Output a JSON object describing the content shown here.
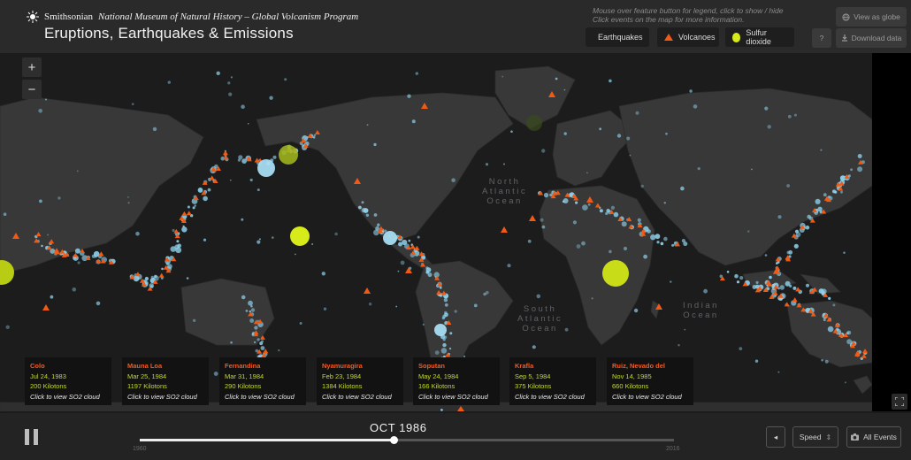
{
  "header": {
    "org_lead": "Smithsonian",
    "org_rest": "National Museum of Natural History – Global Volcanism Program",
    "title": "Eruptions, Earthquakes & Emissions",
    "hint_line1": "Mouse over feature button for legend, click to show / hide",
    "hint_line2": "Click events on the map for more information.",
    "legend": {
      "earthquakes": "Earthquakes",
      "volcanoes": "Volcanoes",
      "so2": "Sulfur dioxide"
    },
    "globe_button": "View as globe",
    "help_button": "?",
    "download_button": "Download data"
  },
  "map": {
    "zoom_in": "+",
    "zoom_out": "−",
    "oceans": {
      "north_atlantic": "North\nAtlantic\nOcean",
      "south_atlantic": "South\nAtlantic\nOcean",
      "indian": "Indian\nOcean"
    }
  },
  "events": [
    {
      "name": "Colo",
      "date": "Jul 24, 1983",
      "kilotons": "200 Kilotons",
      "link": "Click to view SO2 cloud"
    },
    {
      "name": "Mauna Loa",
      "date": "Mar 25, 1984",
      "kilotons": "1197 Kilotons",
      "link": "Click to view SO2 cloud"
    },
    {
      "name": "Fernandina",
      "date": "Mar 31, 1984",
      "kilotons": "290 Kilotons",
      "link": "Click to view SO2 cloud"
    },
    {
      "name": "Nyamuragira",
      "date": "Feb 23, 1984",
      "kilotons": "1384 Kilotons",
      "link": "Click to view SO2 cloud"
    },
    {
      "name": "Soputan",
      "date": "May 24, 1984",
      "kilotons": "166 Kilotons",
      "link": "Click to view SO2 cloud"
    },
    {
      "name": "Krafla",
      "date": "Sep 5, 1984",
      "kilotons": "375 Kilotons",
      "link": "Click to view SO2 cloud"
    },
    {
      "name": "Ruiz, Nevado del",
      "date": "Nov 14, 1985",
      "kilotons": "660 Kilotons",
      "link": "Click to view SO2 cloud"
    }
  ],
  "timeline": {
    "current_date": "OCT  1986",
    "start_year": "1960",
    "end_year": "2016",
    "progress_fraction": 0.475,
    "speed_label": "Speed",
    "speed_arrows": "⇕",
    "all_events_label": "All Events",
    "prev_label": "◂"
  },
  "colors": {
    "earthquake": "#8fd3ee",
    "volcano": "#f05a14",
    "so2": "#d7ea1a"
  }
}
